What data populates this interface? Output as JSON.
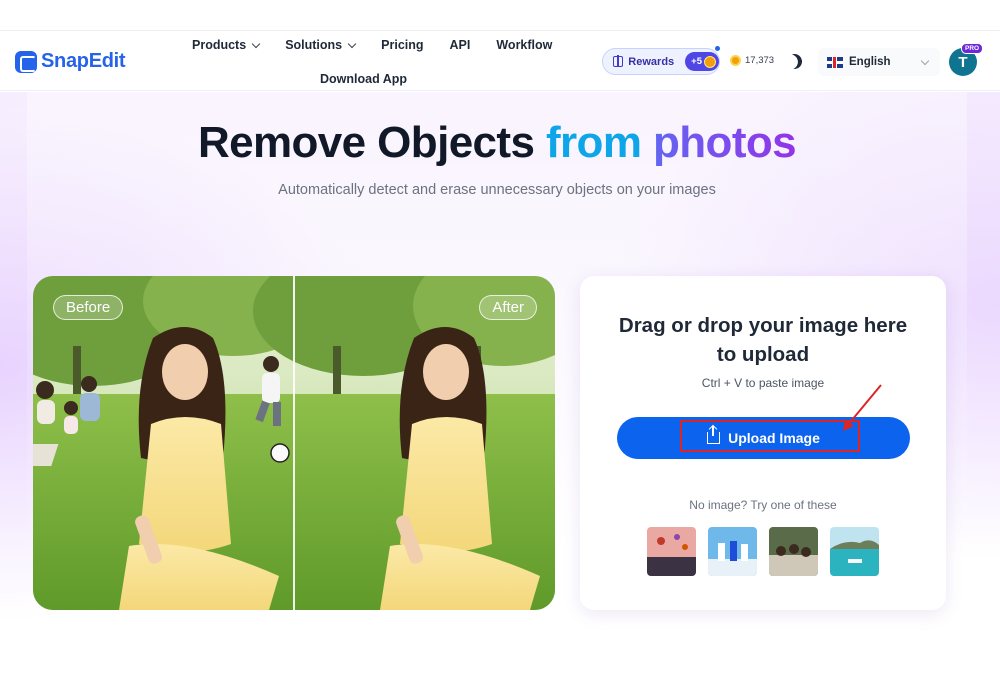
{
  "brand": {
    "name": "SnapEdit"
  },
  "nav": {
    "items": [
      {
        "label": "Products",
        "dropdown": true
      },
      {
        "label": "Solutions",
        "dropdown": true
      },
      {
        "label": "Pricing",
        "dropdown": false
      },
      {
        "label": "API",
        "dropdown": false
      },
      {
        "label": "Workflow",
        "dropdown": false
      }
    ],
    "download_app": "Download App"
  },
  "header": {
    "rewards_label": "Rewards",
    "rewards_bonus": "+5",
    "credits": "17,373",
    "language": "English",
    "avatar_initial": "T",
    "pro_badge": "PRO"
  },
  "hero": {
    "title_part1": "Remove Objects ",
    "title_part2": "from ",
    "title_part3": "photos",
    "subtitle": "Automatically detect and erase unnecessary objects on your images"
  },
  "compare": {
    "before_label": "Before",
    "after_label": "After"
  },
  "upload": {
    "drop_text_line1": "Drag or drop your image here",
    "drop_text_line2": "to upload",
    "paste_hint": "Ctrl + V to paste image",
    "button_label": "Upload Image",
    "sample_hint": "No image? Try one of these",
    "samples": [
      "sample-balloons",
      "sample-people-beach",
      "sample-group-photo",
      "sample-boat-sea"
    ]
  },
  "colors": {
    "brand_blue": "#2563eb",
    "button_blue": "#0b63ee",
    "title_cyan": "#0ea5e9",
    "title_purple": "#7e22ce",
    "annotation_red": "#dc2626"
  }
}
